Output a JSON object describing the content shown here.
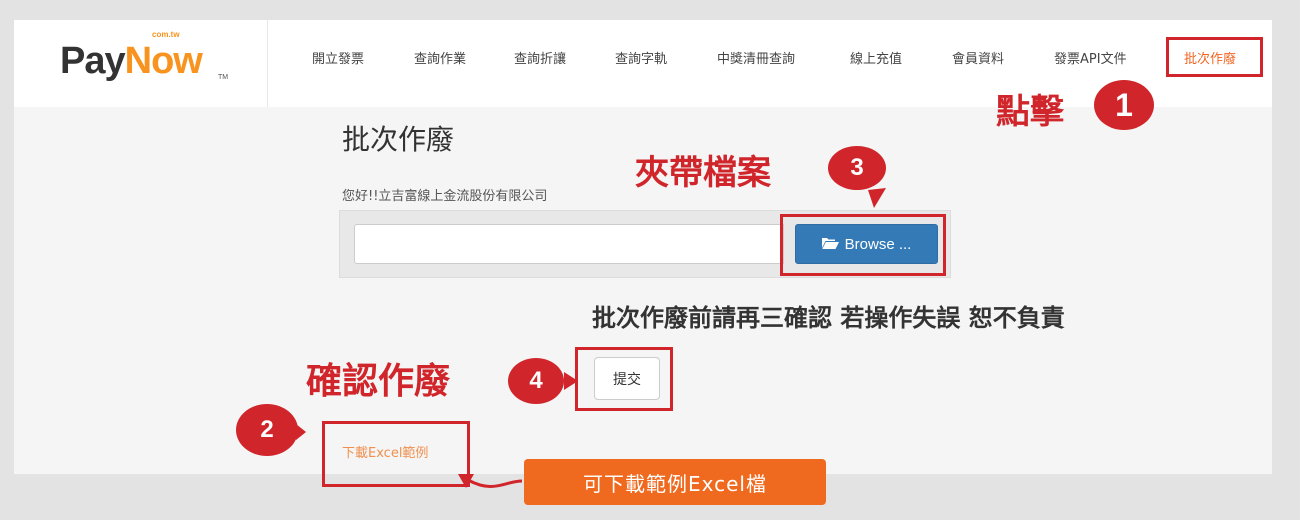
{
  "logo": {
    "pay": "Pay",
    "now": "Now",
    "sub": "com.tw",
    "tm": "TM"
  },
  "nav": {
    "items": [
      "開立發票",
      "查詢作業",
      "查詢折讓",
      "查詢字軌",
      "中獎清冊查詢",
      "線上充值",
      "會員資料",
      "發票API文件",
      "批次作廢"
    ],
    "active_index": 8
  },
  "main": {
    "title": "批次作廢",
    "greeting": "您好!!立吉富線上金流股份有限公司",
    "file_input_value": "",
    "browse_label": "Browse ...",
    "warning": "批次作廢前請再三確認 若操作失誤 恕不負責",
    "submit_label": "提交",
    "download_label": "下載Excel範例"
  },
  "annotations": {
    "step1": {
      "text": "點擊",
      "num": "1"
    },
    "step2": {
      "num": "2"
    },
    "step3": {
      "text": "夾帶檔案",
      "num": "3"
    },
    "step4": {
      "text": "確認作廢",
      "num": "4"
    },
    "callout": "可下載範例Excel檔"
  },
  "colors": {
    "accent": "#d0262b",
    "brand_orange": "#f7931e",
    "callout": "#ef6a1f",
    "primary_button": "#337ab7"
  },
  "icons": {
    "browse": "folder-open-icon"
  }
}
